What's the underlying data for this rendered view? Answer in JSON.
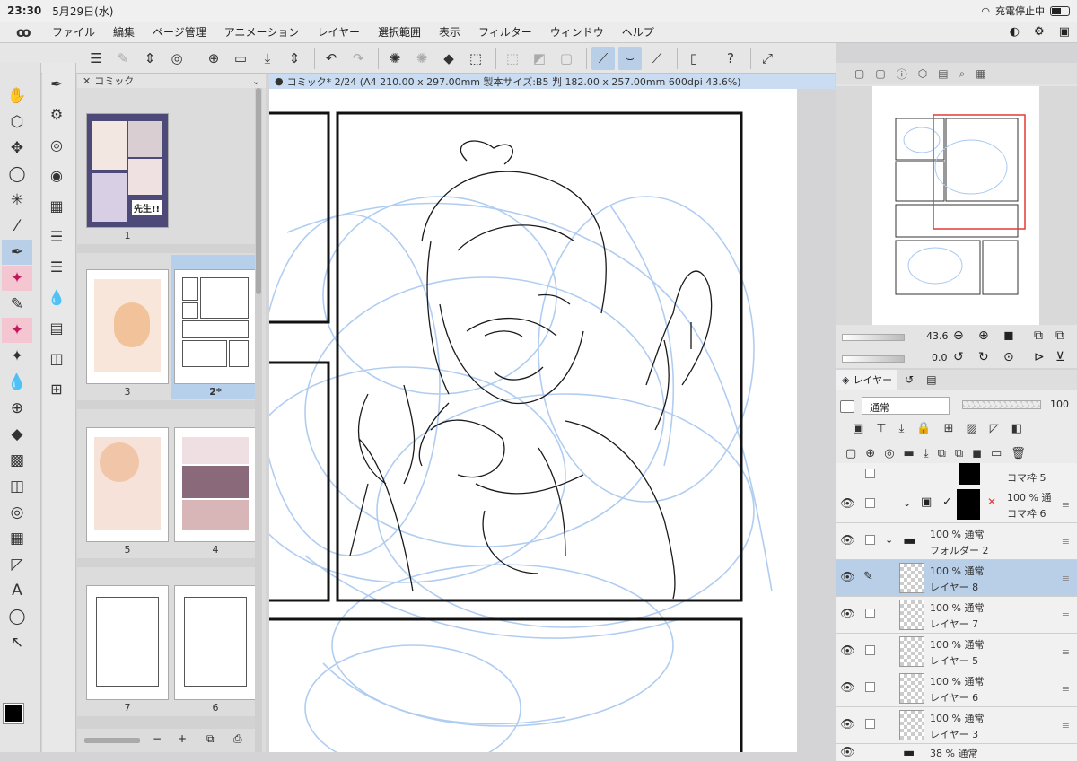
{
  "status": {
    "time": "23:30",
    "date": "5月29日(水)",
    "charging": "充電停止中"
  },
  "menu": {
    "items": [
      "ファイル",
      "編集",
      "ページ管理",
      "アニメーション",
      "レイヤー",
      "選択範囲",
      "表示",
      "フィルター",
      "ウィンドウ",
      "ヘルプ"
    ]
  },
  "page_manager": {
    "title": "コミック",
    "pages": [
      {
        "label": "1"
      },
      {
        "label": "3"
      },
      {
        "label": "2*",
        "selected": true
      },
      {
        "label": "5"
      },
      {
        "label": "4"
      },
      {
        "label": "7"
      },
      {
        "label": "6"
      }
    ],
    "thumb_text": "先生!!"
  },
  "canvas": {
    "tab_title": "コミック* 2/24 (A4 210.00 x 297.00mm 製本サイズ:B5 判 182.00 x 257.00mm 600dpi 43.6%)"
  },
  "navigator": {
    "zoom": "43.6",
    "rotation": "0.0"
  },
  "layer_panel": {
    "tab_label": "レイヤー",
    "blend_mode": "通常",
    "opacity": "100",
    "layers": [
      {
        "pct": "",
        "name": "コマ枠 5",
        "kind": "frame"
      },
      {
        "pct": "100 % 通",
        "name": "コマ枠 6",
        "kind": "frame"
      },
      {
        "pct": "100 % 通常",
        "name": "フォルダー 2",
        "kind": "folder"
      },
      {
        "pct": "100 % 通常",
        "name": "レイヤー 8",
        "kind": "raster",
        "selected": true
      },
      {
        "pct": "100 % 通常",
        "name": "レイヤー 7",
        "kind": "raster"
      },
      {
        "pct": "100 % 通常",
        "name": "レイヤー 5",
        "kind": "raster"
      },
      {
        "pct": "100 % 通常",
        "name": "レイヤー 6",
        "kind": "raster"
      },
      {
        "pct": "100 % 通常",
        "name": "レイヤー 3",
        "kind": "raster"
      },
      {
        "pct": "38 % 通常",
        "name": "",
        "kind": "folder"
      }
    ]
  },
  "colors": {
    "accent": "#b9cfe8",
    "sketch_blue": "#a8c8f0",
    "nav_frame": "#e53935"
  }
}
